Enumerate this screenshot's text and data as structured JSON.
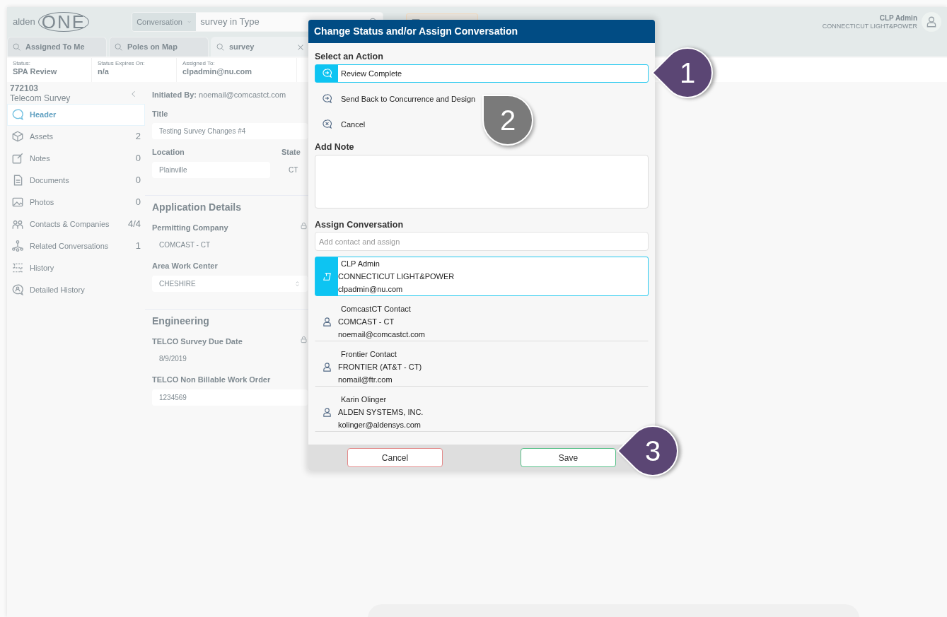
{
  "app": {
    "logo": {
      "word": "alden",
      "mark": "ONE"
    },
    "search": {
      "scope": "Conversation",
      "value": "survey in Type"
    },
    "user": {
      "name": "CLP Admin",
      "company": "CONNECTICUT LIGHT&POWER"
    },
    "tabs": [
      {
        "label": "Assigned To Me",
        "selected": false,
        "closable": false
      },
      {
        "label": "Poles on Map",
        "selected": false,
        "closable": false
      },
      {
        "label": "survey",
        "selected": true,
        "closable": true
      }
    ],
    "status_fields": [
      {
        "label": "Status:",
        "value": "SPA Review"
      },
      {
        "label": "Status Expires On:",
        "value": "n/a"
      },
      {
        "label": "Assigned To:",
        "value": "clpadmin@nu.com"
      }
    ],
    "record": {
      "id": "772103",
      "type": "Telecom Survey"
    },
    "sidebar": {
      "items": [
        {
          "label": "Header",
          "selected": true
        },
        {
          "label": "Assets",
          "count": "2",
          "selected": false
        },
        {
          "label": "Notes",
          "count": "0",
          "selected": false
        },
        {
          "label": "Documents",
          "count": "0",
          "selected": false
        },
        {
          "label": "Photos",
          "count": "0",
          "selected": false
        },
        {
          "label": "Contacts & Companies",
          "count": "4/4",
          "selected": false
        },
        {
          "label": "Related Conversations",
          "count": "1",
          "selected": false
        },
        {
          "label": "History",
          "selected": false
        },
        {
          "label": "Detailed History",
          "selected": false
        }
      ]
    },
    "initiated_by": {
      "label": "Initiated By:",
      "value": "noemail@comcastct.com"
    },
    "form": {
      "title": {
        "label": "Title",
        "value": "Testing Survey Changes #4"
      },
      "location": {
        "label": "Location",
        "value": "Plainville"
      },
      "state": {
        "label": "State",
        "value": "CT"
      },
      "sections": [
        {
          "heading": "Application Details",
          "fields": [
            {
              "label": "Permitting Company",
              "value": "COMCAST - CT",
              "kind": "locked"
            },
            {
              "label": "Area Work Center",
              "value": "CHESHIRE",
              "kind": "select"
            }
          ]
        },
        {
          "heading": "Engineering",
          "fields": [
            {
              "label": "TELCO Survey Due Date",
              "value": "8/9/2019",
              "kind": "locked"
            },
            {
              "label": "TELCO Non Billable Work Order",
              "value": "1234569",
              "kind": "input"
            }
          ]
        }
      ]
    }
  },
  "dialog": {
    "title": "Change Status and/or Assign Conversation",
    "action_heading": "Select an Action",
    "actions": [
      {
        "label": "Review Complete",
        "kind": "forward",
        "selected": true
      },
      {
        "label": "Send Back to Concurrence and Design",
        "kind": "forward",
        "selected": false
      },
      {
        "label": "Cancel",
        "kind": "cancel",
        "selected": false
      }
    ],
    "note_heading": "Add Note",
    "assign_heading": "Assign Conversation",
    "assign_search": {
      "placeholder": "Add contact and assign"
    },
    "contacts": [
      {
        "name": "CLP Admin",
        "company": "CONNECTICUT LIGHT&POWER",
        "email": "clpadmin@nu.com",
        "selected": true
      },
      {
        "name": "ComcastCT Contact",
        "company": "COMCAST - CT",
        "email": "noemail@comcastct.com",
        "selected": false
      },
      {
        "name": "Frontier Contact",
        "company": "FRONTIER (AT&T - CT)",
        "email": "nomail@ftr.com",
        "selected": false
      },
      {
        "name": "Karin Olinger",
        "company": "ALDEN SYSTEMS, INC.",
        "email": "kolinger@aldensys.com",
        "selected": false
      }
    ],
    "buttons": [
      {
        "label": "Cancel",
        "kind": "cancel"
      },
      {
        "label": "Save",
        "kind": "save"
      }
    ]
  },
  "callouts": [
    {
      "label": "1",
      "color": "#5b4674"
    },
    {
      "label": "2",
      "color": "#7a7a7a"
    },
    {
      "label": "3",
      "color": "#5b4674"
    }
  ]
}
